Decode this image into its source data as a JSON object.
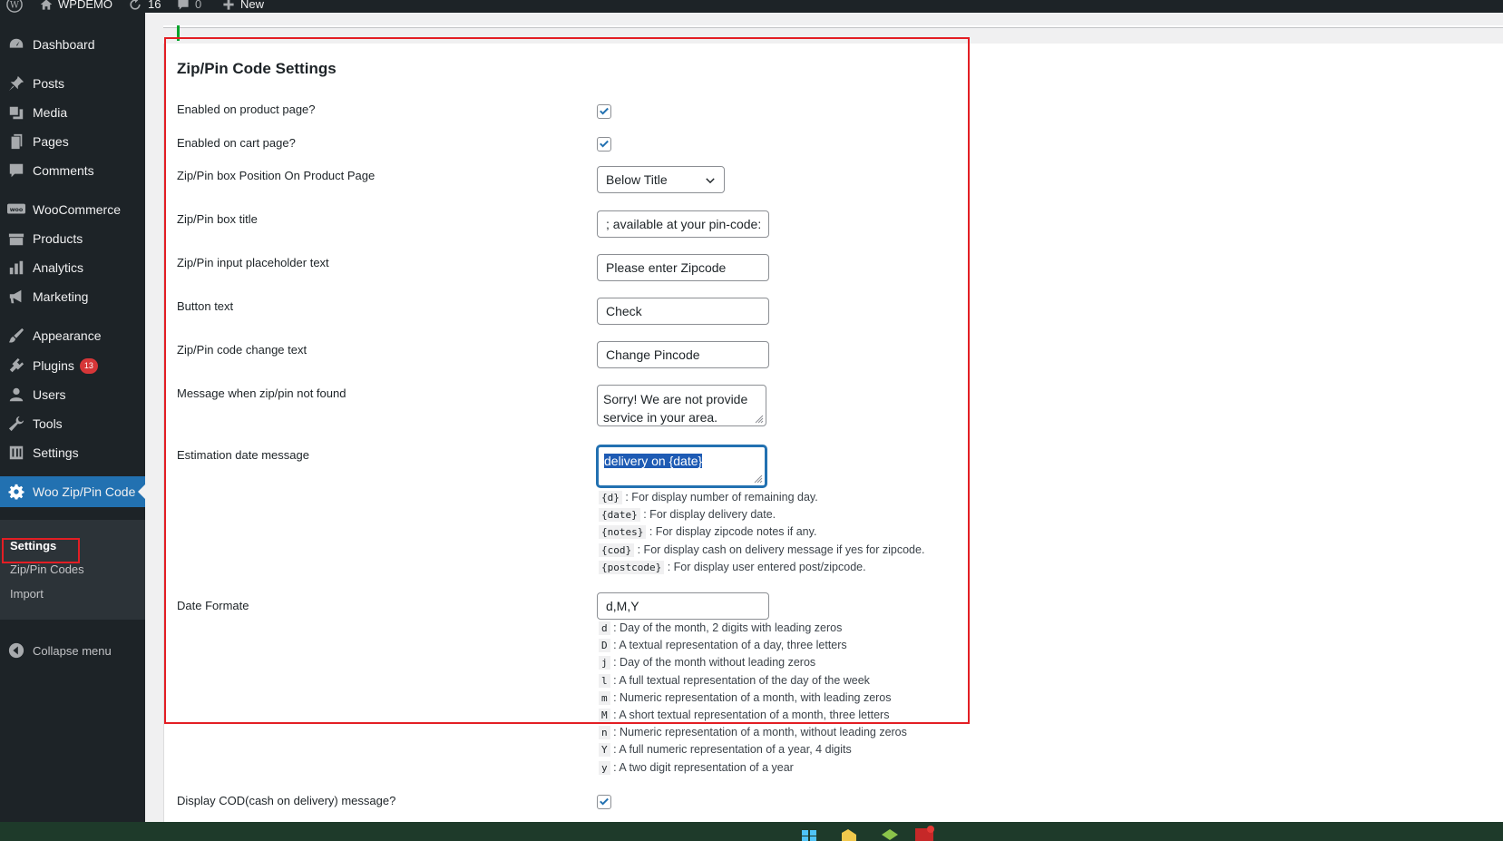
{
  "adminbar": {
    "site_name": "WPDEMO",
    "updates_count": "16",
    "comments_count": "0",
    "new_label": "New"
  },
  "sidebar": {
    "items": [
      {
        "label": "Dashboard",
        "icon": "dashboard-icon"
      },
      {
        "label": "Posts",
        "icon": "pin-icon"
      },
      {
        "label": "Media",
        "icon": "media-icon"
      },
      {
        "label": "Pages",
        "icon": "pages-icon"
      },
      {
        "label": "Comments",
        "icon": "comments-icon"
      },
      {
        "label": "WooCommerce",
        "icon": "woo-icon"
      },
      {
        "label": "Products",
        "icon": "products-icon"
      },
      {
        "label": "Analytics",
        "icon": "analytics-icon"
      },
      {
        "label": "Marketing",
        "icon": "megaphone-icon"
      },
      {
        "label": "Appearance",
        "icon": "brush-icon"
      },
      {
        "label": "Plugins",
        "icon": "plugins-icon",
        "badge": "13"
      },
      {
        "label": "Users",
        "icon": "users-icon"
      },
      {
        "label": "Tools",
        "icon": "wrench-icon"
      },
      {
        "label": "Settings",
        "icon": "settings-sliders-icon"
      },
      {
        "label": "Woo Zip/Pin Code",
        "icon": "gear-icon",
        "current": true
      }
    ],
    "submenu": [
      "Settings",
      "Zip/Pin Codes",
      "Import"
    ],
    "collapse_label": "Collapse menu"
  },
  "settings": {
    "title": "Zip/Pin Code Settings",
    "enabled_product_label": "Enabled on product page?",
    "enabled_product_checked": true,
    "enabled_cart_label": "Enabled on cart page?",
    "enabled_cart_checked": true,
    "position_label": "Zip/Pin box Position On Product Page",
    "position_value": "Below Title",
    "box_title_label": "Zip/Pin box title",
    "box_title_value": "; available at your pin-code:",
    "placeholder_label": "Zip/Pin input placeholder text",
    "placeholder_value": "Please enter Zipcode",
    "button_text_label": "Button text",
    "button_text_value": "Check",
    "change_text_label": "Zip/Pin code change text",
    "change_text_value": "Change Pincode",
    "not_found_label": "Message when zip/pin not found",
    "not_found_value": "Sorry! We are not provide service in your area.",
    "estimation_label": "Estimation date message",
    "estimation_value": "delivery on {date}",
    "estimation_help": [
      {
        "code": "{d}",
        "text": ": For display number of remaining day."
      },
      {
        "code": "{date}",
        "text": ": For display delivery date."
      },
      {
        "code": "{notes}",
        "text": ": For display zipcode notes if any."
      },
      {
        "code": "{cod}",
        "text": ": For display cash on delivery message if yes for zipcode."
      },
      {
        "code": "{postcode}",
        "text": ": For display user entered post/zipcode."
      }
    ],
    "date_format_label": "Date Formate",
    "date_format_value": "d,M,Y",
    "date_help": [
      {
        "code": "d",
        "text": ": Day of the month, 2 digits with leading zeros"
      },
      {
        "code": "D",
        "text": ": A textual representation of a day, three letters"
      },
      {
        "code": "j",
        "text": ": Day of the month without leading zeros"
      },
      {
        "code": "l",
        "text": ": A full textual representation of the day of the week"
      },
      {
        "code": "m",
        "text": ": Numeric representation of a month, with leading zeros"
      },
      {
        "code": "M",
        "text": ": A short textual representation of a month, three letters"
      },
      {
        "code": "n",
        "text": ": Numeric representation of a month, without leading zeros"
      },
      {
        "code": "Y",
        "text": ": A full numeric representation of a year, 4 digits"
      },
      {
        "code": "y",
        "text": ": A two digit representation of a year"
      }
    ],
    "cod_label": "Display COD(cash on delivery) message?",
    "cod_checked": true
  },
  "colors": {
    "admin_dark": "#1d2327",
    "accent_blue": "#2271b1",
    "highlight_red": "#e31e24",
    "badge_red": "#d63638"
  }
}
